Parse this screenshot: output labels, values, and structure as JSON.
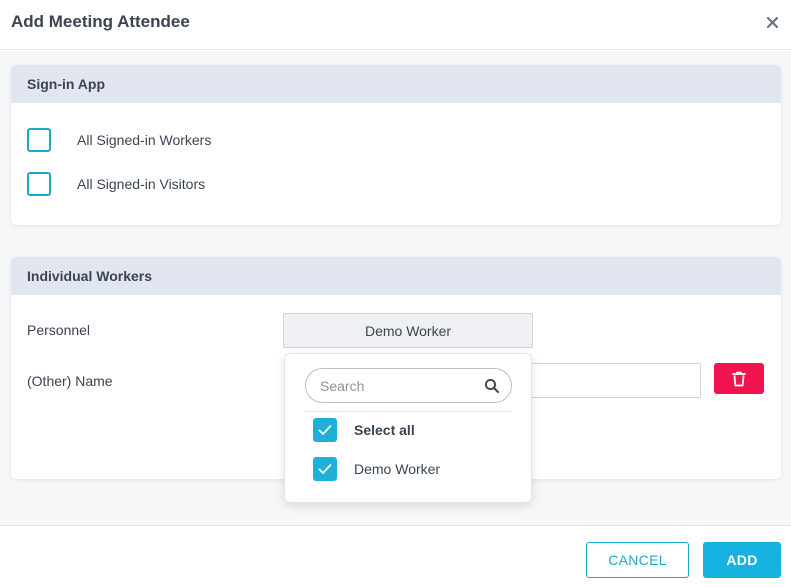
{
  "modal": {
    "title": "Add Meeting Attendee"
  },
  "signin_app": {
    "heading": "Sign-in App",
    "options": [
      {
        "label": "All Signed-in Workers",
        "checked": false
      },
      {
        "label": "All Signed-in Visitors",
        "checked": false
      }
    ]
  },
  "individual_workers": {
    "heading": "Individual Workers",
    "personnel_label": "Personnel",
    "personnel_selected": "Demo Worker",
    "other_name_label": "(Other) Name",
    "other_name_value": ""
  },
  "dropdown": {
    "search_placeholder": "Search",
    "items": [
      {
        "label": "Select all",
        "checked": true
      },
      {
        "label": "Demo Worker",
        "checked": true
      }
    ]
  },
  "footer": {
    "cancel_label": "CANCEL",
    "add_label": "ADD"
  },
  "colors": {
    "accent": "#1fa7c9",
    "primary_button": "#17b3e0",
    "danger": "#f2144f",
    "card_header": "#e2e6f0"
  }
}
